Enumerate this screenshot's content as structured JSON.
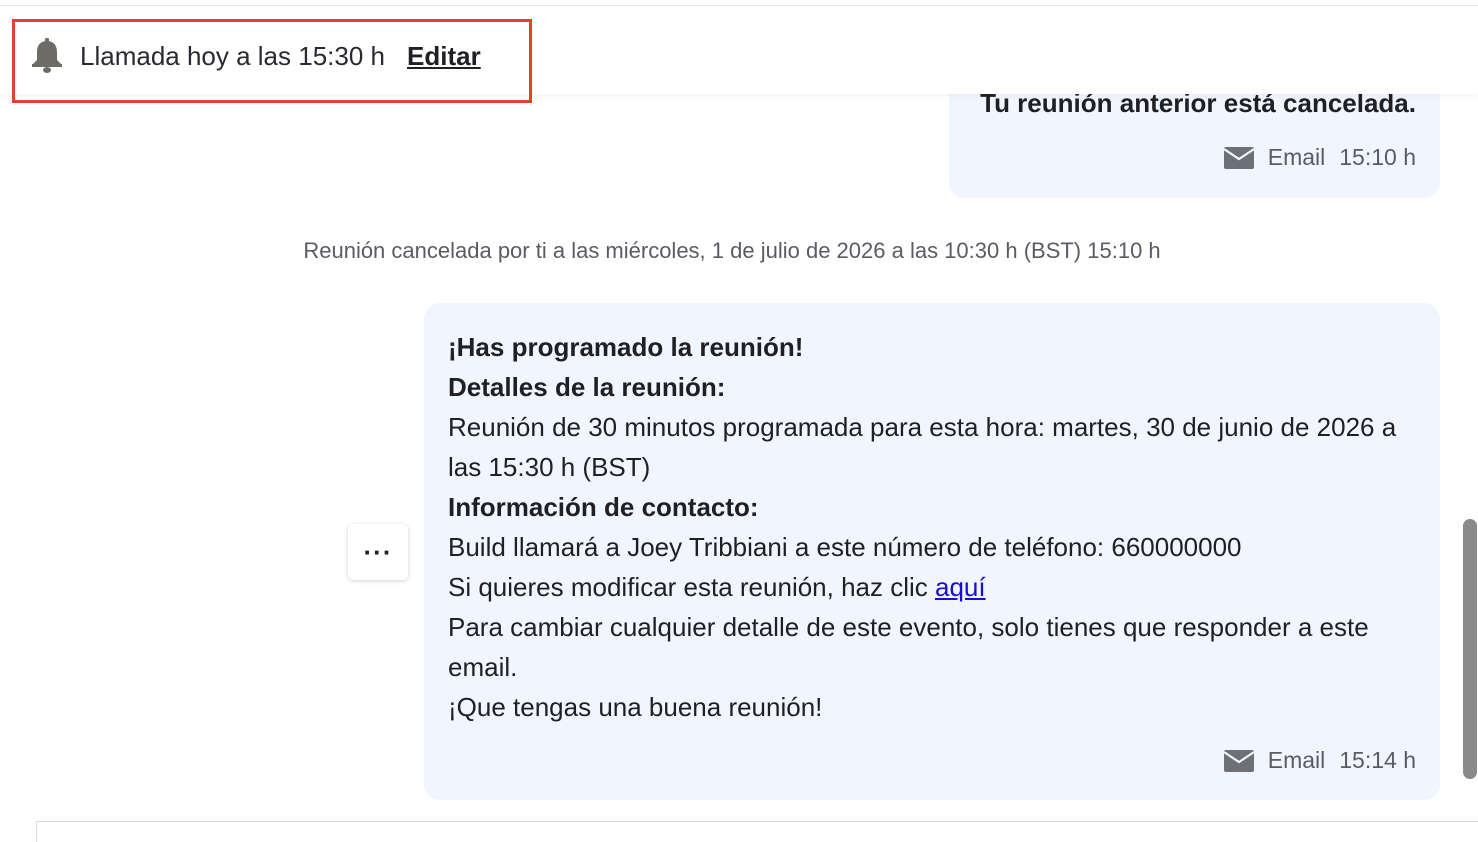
{
  "reminder": {
    "text": "Llamada hoy a las 15:30 h",
    "edit_label": "Editar",
    "icon": "bell-icon"
  },
  "messages": [
    {
      "text": "Tu reunión anterior está cancelada.",
      "channel": "Email",
      "time": "15:10 h"
    },
    {
      "title": "¡Has programado la reunión!",
      "details_heading": "Detalles de la reunión:",
      "details_text": "Reunión de 30 minutos programada para esta hora: martes, 30 de junio de 2026 a las 15:30 h (BST)",
      "contact_heading": "Información de contacto:",
      "contact_text": "Build llamará a Joey Tribbiani a este número de teléfono: 660000000",
      "modify_text": "Si quieres modificar esta reunión, haz clic ",
      "modify_link": "aquí",
      "change_text": "Para cambiar cualquier detalle de este evento, solo tienes que responder a este email.",
      "closing": "¡Que tengas una buena reunión!",
      "channel": "Email",
      "time": "15:14 h"
    }
  ],
  "system_note": "Reunión cancelada por ti a las miércoles, 1 de julio de 2026 a las 10:30 h (BST) 15:10 h",
  "more_button_label": "···",
  "colors": {
    "bubble_bg": "#f1f5fd",
    "highlight": "#e2432f",
    "link": "#1a0dcc",
    "meta_text": "#5b5b63"
  }
}
